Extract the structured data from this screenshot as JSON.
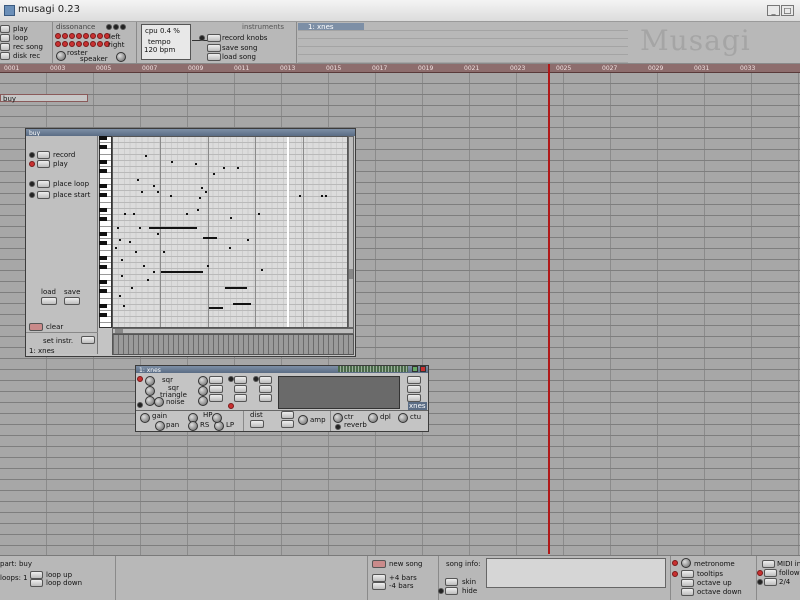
{
  "window": {
    "title": "musagi 0.23"
  },
  "transport": {
    "play": "play",
    "loop": "loop",
    "rec_song": "rec song",
    "disk_rec": "disk rec"
  },
  "dissonance": {
    "label": "dissonance",
    "left": "left",
    "right": "right",
    "roster": "roster",
    "speaker": "speaker"
  },
  "tempo": {
    "cpu": "cpu 0.4 %",
    "tempo_label": "tempo",
    "bpm": "120 bpm"
  },
  "song_buttons": {
    "record_knobs": "record knobs",
    "save_song": "save song",
    "load_song": "load song"
  },
  "instruments": {
    "header": "instruments",
    "item1": "1: xnes"
  },
  "logo": "Musagi",
  "ruler": {
    "ticks": [
      "0001",
      "0003",
      "0005",
      "0007",
      "0009",
      "0011",
      "0013",
      "0015",
      "0017",
      "0019",
      "0021",
      "0023",
      "0025",
      "0027",
      "0029",
      "0031",
      "0033"
    ]
  },
  "track": {
    "part_label": "buy"
  },
  "pianoroll": {
    "title": "buy",
    "record": "record",
    "play": "play",
    "place_loop": "place loop",
    "place_start": "place start",
    "load": "load",
    "save": "save",
    "clear": "clear",
    "set_instr": "set instr.",
    "instrument": "1: xnes"
  },
  "mixer": {
    "title": "1: xnes",
    "sqr1": "sqr",
    "sqr2": "sqr",
    "triangle": "triangle",
    "noise": "noise",
    "gain": "gain",
    "pan": "pan",
    "hp": "HP",
    "rs": "RS",
    "lp": "LP",
    "dist": "dist",
    "amp": "amp",
    "ctr": "ctr",
    "dpl": "dpl",
    "ctu": "ctu",
    "reverb": "reverb",
    "xnes_label": "xnes"
  },
  "bottom": {
    "part": "part: buy",
    "loops": "loops: 1",
    "loop_up": "loop up",
    "loop_down": "loop down",
    "new_song": "new song",
    "plus4": "+4 bars",
    "minus4": "-4 bars",
    "song_info": "song info:",
    "skin": "skin",
    "hide": "hide",
    "metronome": "metronome",
    "tooltips": "tooltips",
    "octave_up": "octave up",
    "octave_down": "octave down",
    "midi_in": "MIDI in",
    "follow": "follow",
    "fx": "2/4"
  },
  "colors": {
    "playhead": "#b01818",
    "ruler": "#8d6d6d",
    "led_red": "#c83030"
  }
}
